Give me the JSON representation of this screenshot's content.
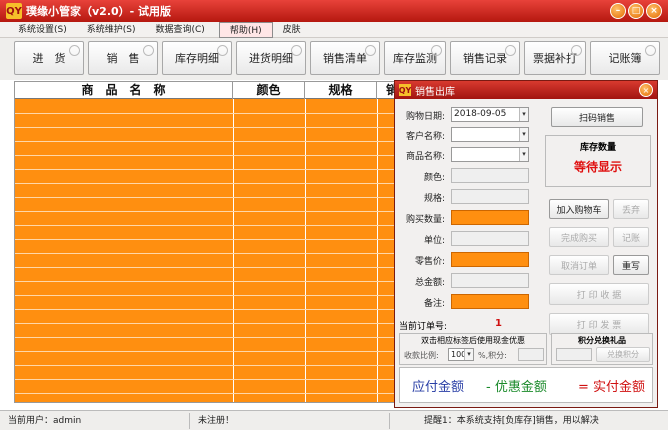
{
  "window": {
    "title": "璞缘小管家（v2.0）- 试用版",
    "logo": "QY"
  },
  "menus": [
    "系统设置(S)",
    "系统维护(S)",
    "数据查询(C)",
    "帮助(H)",
    "皮肤"
  ],
  "toolbar": [
    "进　货",
    "销　售",
    "库存明细",
    "进货明细",
    "销售清单",
    "库存监测",
    "销售记录",
    "票据补打",
    "记账簿"
  ],
  "table": {
    "headers": [
      "商　品　名　称",
      "颜色",
      "规格",
      "销"
    ]
  },
  "status": {
    "user": "当前用户：admin",
    "reg": "未注册！",
    "tip": "提醒1：本系统支持[负库存]销售，用以解决"
  },
  "dialog": {
    "title": "销售出库",
    "labels": {
      "date": "购物日期:",
      "customer": "客户名称:",
      "product": "商品名称:",
      "color": "颜色:",
      "spec": "规格:",
      "qty": "购买数量:",
      "unit": "单位:",
      "price": "零售价:",
      "amount": "总金额:",
      "remark": "备注:"
    },
    "date_value": "2018-09-05",
    "scan_btn": "扫码销售",
    "stock": {
      "title": "库存数量",
      "value": "等待显示"
    },
    "buttons": {
      "add_cart": "加入购物车",
      "delete": "丢弃",
      "done": "完成购买",
      "account": "记账",
      "cancel": "取消订单",
      "rewrite": "重写",
      "print_receipt": "打 印 收 据",
      "print_invoice": "打 印 发 票"
    },
    "order_label": "当前订单号:",
    "order_value": "1",
    "discount_title": "双击相应标签后使用现金优惠",
    "discount_label": "收款比例:",
    "discount_value": "100",
    "percent_label": "%,积分:",
    "points_title": "积分兑换礼品",
    "points_btn": "兑换积分",
    "total_label": "应付金额",
    "discount_amount_label": "- 优惠金额",
    "paid_label": "= 实付金额"
  }
}
